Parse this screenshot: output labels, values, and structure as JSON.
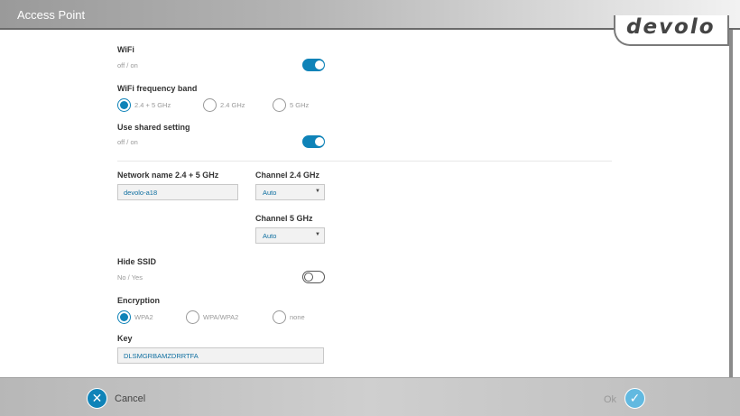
{
  "window": {
    "title": "Access Point",
    "logo": "devolo"
  },
  "wifi": {
    "label": "WiFi",
    "sub": "off / on",
    "state": "on"
  },
  "band": {
    "label": "WiFi frequency band",
    "options": [
      "2.4 + 5 GHz",
      "2.4 GHz",
      "5 GHz"
    ],
    "selected": "2.4 + 5 GHz"
  },
  "shared": {
    "label": "Use shared setting",
    "sub": "off / on",
    "state": "on"
  },
  "network": {
    "label": "Network name 2.4 + 5 GHz",
    "value": "devolo-a18"
  },
  "channel24": {
    "label": "Channel 2.4 GHz",
    "value": "Auto"
  },
  "channel5": {
    "label": "Channel 5 GHz",
    "value": "Auto"
  },
  "hide_ssid": {
    "label": "Hide SSID",
    "sub": "No / Yes",
    "state": "off"
  },
  "encryption": {
    "label": "Encryption",
    "options": [
      "WPA2",
      "WPA/WPA2",
      "none"
    ],
    "selected": "WPA2"
  },
  "key": {
    "label": "Key",
    "value": "DLSMGRBAMZDRRTFA"
  },
  "footer": {
    "cancel": "Cancel",
    "ok": "Ok"
  },
  "colors": {
    "accent": "#0f83b8",
    "ok_icon": "#62b9e0"
  },
  "icons": {
    "cancel": "close-icon",
    "ok": "checkmark-icon",
    "select": "caret-down-icon"
  }
}
